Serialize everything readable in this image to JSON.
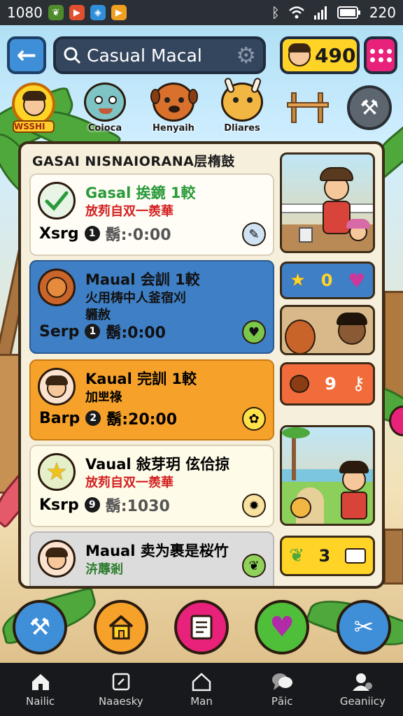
{
  "status_bar": {
    "time": "1080",
    "battery": "220",
    "apps": [
      {
        "icon": "leaf-app-icon",
        "color": "#4e8b2c"
      },
      {
        "icon": "play-store-icon",
        "color": "#e0502f"
      },
      {
        "icon": "blue-app-icon",
        "color": "#2f8fd8"
      },
      {
        "icon": "youtube-icon",
        "color": "#f0a020"
      }
    ]
  },
  "header": {
    "search_text": "Casual Macal",
    "coins": "490"
  },
  "characters": [
    {
      "name": "WSSHI"
    },
    {
      "name": "Coioca"
    },
    {
      "name": "Henyaih"
    },
    {
      "name": "Dliares"
    }
  ],
  "panel": {
    "title": "GASAI NISNAIORANA层楕鼓",
    "quests": [
      {
        "title": "Gasal 挨鏡 1較",
        "desc": "放茢自双一羨華",
        "desc2": "",
        "label": "Xsrg",
        "num": "1",
        "time": "鬍:·0:00",
        "title_color": "#2a9a3a",
        "desc_color": "#d22020"
      },
      {
        "title": "Maual 会訓 1較",
        "desc": "火用梼中人釜宿刈",
        "desc2": "軅赦",
        "label": "Serp",
        "num": "1",
        "time": "鬍:0:00",
        "title_color": "#111111",
        "desc_color": "#111111"
      },
      {
        "title": "Kaual 完訓 1較",
        "desc": "加뽀祿",
        "desc2": "",
        "label": "Barp",
        "num": "2",
        "time": "鬍:20:00",
        "title_color": "#111111",
        "desc_color": "#111111"
      },
      {
        "title": "Vaual 敍芽玥 伭佮掠",
        "desc": "放茢自双一羨華",
        "desc2": "",
        "label": "Ksrp",
        "num": "9",
        "time": "鬍:1030",
        "title_color": "#111111",
        "desc_color": "#d22020"
      },
      {
        "title": "Maual 卖为裹是桜竹",
        "desc": "泋蓐剎",
        "desc2": "",
        "label": "",
        "num": "",
        "time": "",
        "title_color": "#111111",
        "desc_color": "#2a7a2a"
      }
    ],
    "stats": [
      {
        "value": "0"
      },
      {
        "value": "9"
      },
      {
        "value": "3"
      }
    ]
  },
  "nav": [
    {
      "label": "Nailic",
      "icon": "home-icon"
    },
    {
      "label": "Naaesky",
      "icon": "task-icon"
    },
    {
      "label": "Man",
      "icon": "house-outline-icon"
    },
    {
      "label": "Pāic",
      "icon": "chat-icon"
    },
    {
      "label": "Geaniicy",
      "icon": "profile-icon"
    }
  ],
  "colors": {
    "accent_blue": "#3f7fc6",
    "accent_orange": "#f6a22a",
    "accent_pink": "#e8217a",
    "coin_yellow": "#ffd426"
  }
}
